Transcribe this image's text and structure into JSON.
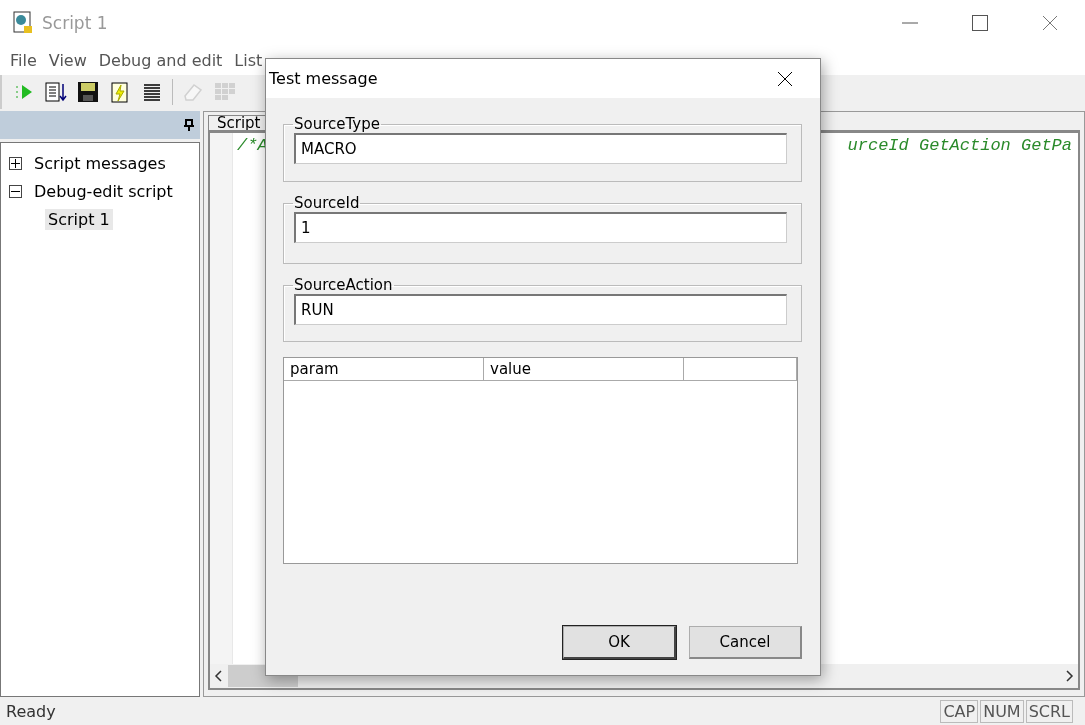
{
  "window": {
    "title": "Script 1"
  },
  "menu": [
    "File",
    "View",
    "Debug and edit",
    "List"
  ],
  "toolbar": [
    {
      "kind": "run",
      "disabled": false
    },
    {
      "kind": "sort",
      "disabled": false
    },
    {
      "kind": "save",
      "disabled": false
    },
    {
      "kind": "flash",
      "disabled": false
    },
    {
      "kind": "lines",
      "disabled": false
    },
    {
      "kind": "separator"
    },
    {
      "kind": "eraser",
      "disabled": true
    },
    {
      "kind": "grid",
      "disabled": true
    }
  ],
  "tree": [
    {
      "label": "Script messages",
      "expanded": false,
      "selected": false
    },
    {
      "label": "Debug-edit script",
      "expanded": true,
      "selected": false,
      "children": [
        {
          "label": "Script 1",
          "selected": true
        }
      ]
    }
  ],
  "editor": {
    "tab": "Script",
    "code_left": "/*A",
    "code_right": "urceId GetAction GetPa"
  },
  "status_bar": {
    "text": "Ready",
    "indicators": [
      "CAP",
      "NUM",
      "SCRL"
    ]
  },
  "dialog": {
    "title": "Test message",
    "groups": [
      {
        "label": "SourceType",
        "value": "MACRO"
      },
      {
        "label": "SourceId",
        "value": "1"
      },
      {
        "label": "SourceAction",
        "value": "RUN"
      }
    ],
    "table": {
      "columns": [
        "param",
        "value"
      ]
    },
    "buttons": [
      {
        "label": "OK",
        "default": true
      },
      {
        "label": "Cancel",
        "default": false
      }
    ]
  }
}
